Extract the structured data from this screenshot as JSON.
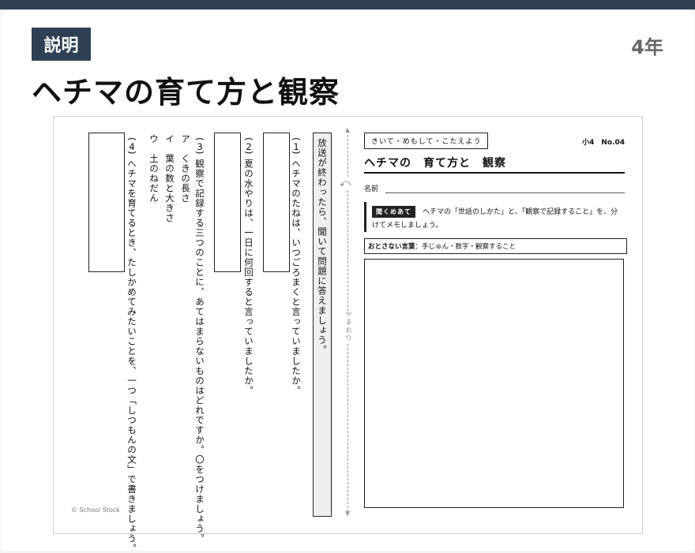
{
  "header": {
    "badge": "説明",
    "grade": "4年",
    "title": "ヘチマの育て方と観察"
  },
  "worksheet": {
    "broadcast_instruction": "放送が終わったら、聞いて問題に答えましょう。",
    "fold_label": "やまおり",
    "copyright": "© School Stock",
    "questions": {
      "q1": {
        "number": "1",
        "text": "ヘチマのたねは、いつごろまくと言っていましたか。"
      },
      "q2": {
        "number": "2",
        "text": "夏の水やりは、一日に何回すると言っていましたか。"
      },
      "q3": {
        "number": "3",
        "text": "観察で記録する三つのことに、あてはまらないものはどれですか。〇をつけましょう。",
        "choices": [
          {
            "mark": "ア",
            "text": "くきの長さ"
          },
          {
            "mark": "イ",
            "text": "葉の数と大きさ"
          },
          {
            "mark": "ウ",
            "text": "土のねだん"
          }
        ]
      },
      "q4": {
        "number": "4",
        "text": "ヘチマを育てるとき、たしかめてみたいことを、一つ「しつもんの文」で書きましょう。"
      }
    },
    "instruction_box": "きいて・めもして・こたえよう",
    "sheet_number": "小4　No.04",
    "sheet_title": "ヘチマの　育て方と　観察",
    "name_label": "名前",
    "listen_tag": "聞くめあて",
    "listen_text": "ヘチマの「世話のしかた」と、「観察で記録すること」を、分けてメモしましょう。",
    "keyword_label": "おとさない言葉",
    "keyword_text": "：手じゅん・数字・観察すること"
  }
}
